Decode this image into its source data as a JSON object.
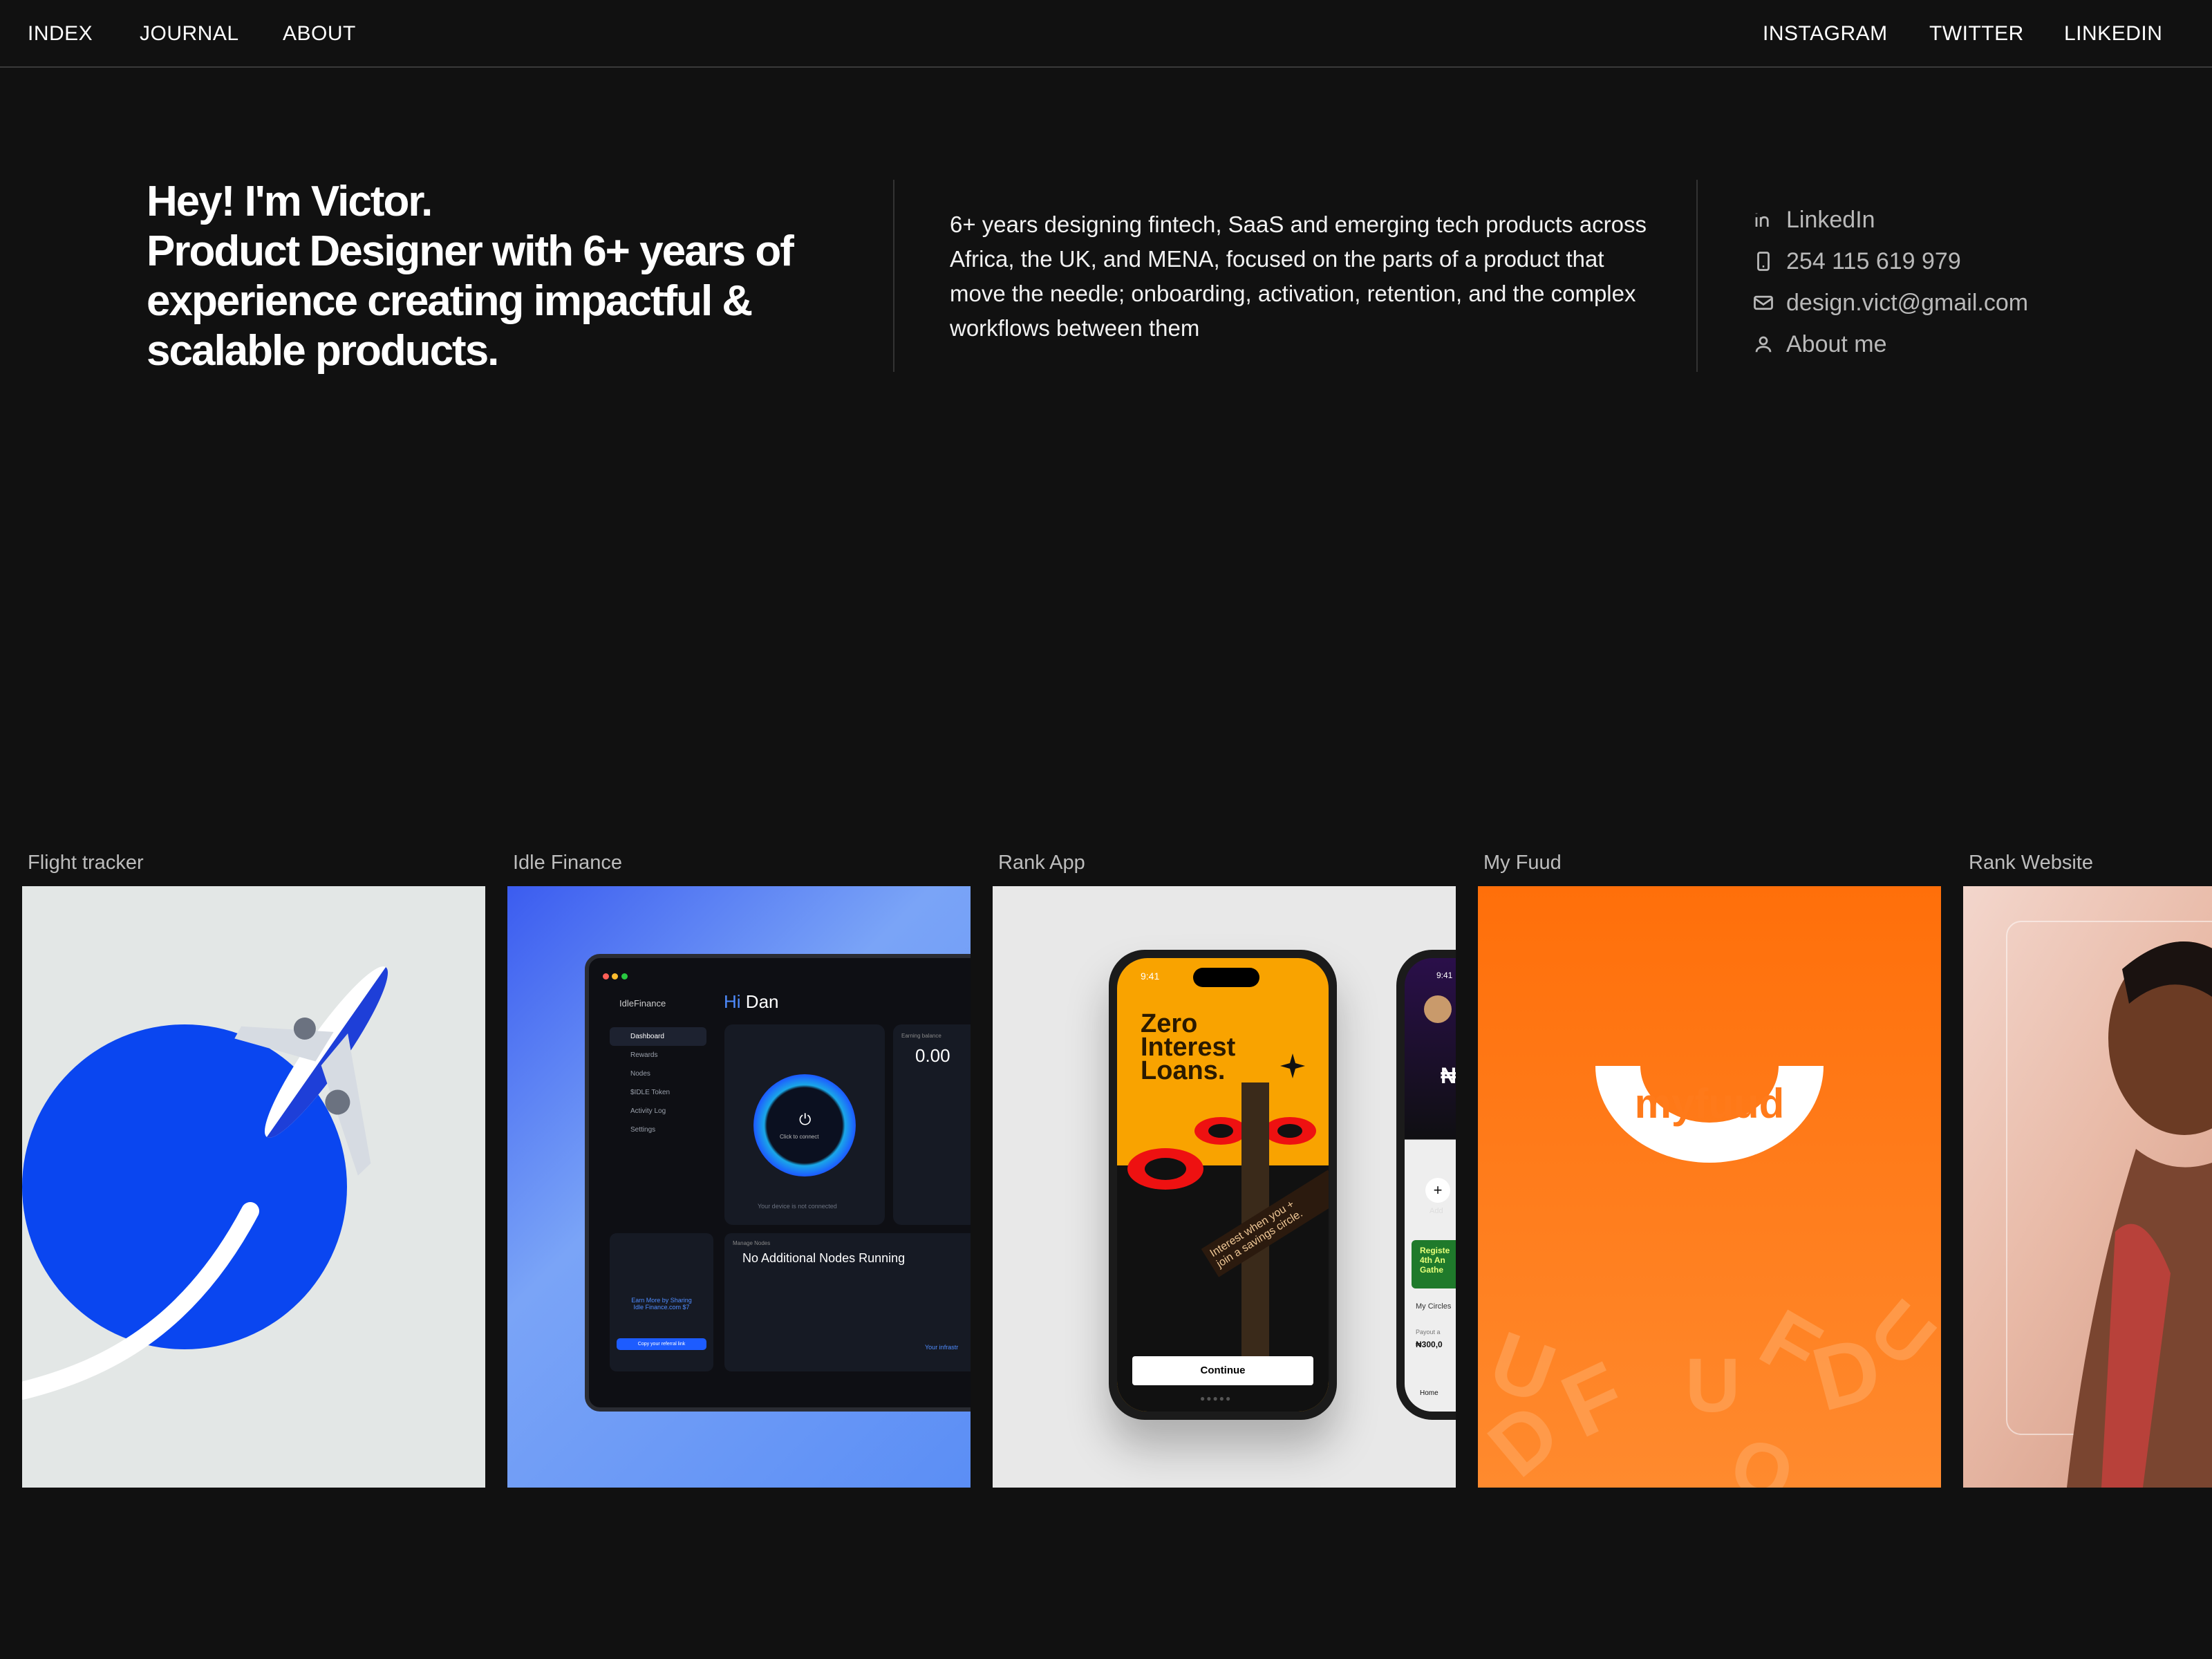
{
  "nav": {
    "left": [
      "INDEX",
      "JOURNAL",
      "ABOUT"
    ],
    "right": [
      "INSTAGRAM",
      "TWITTER",
      "LINKEDIN"
    ]
  },
  "hero": {
    "line1": "Hey! I'm Victor.",
    "line2": "Product Designer with 6+ years of experience creating impactful & scalable products."
  },
  "bio": "6+ years designing fintech, SaaS and emerging tech products across Africa, the UK, and MENA, focused on the parts of a product that move the needle; onboarding, activation, retention, and the complex workflows between them",
  "contacts": [
    {
      "icon": "linkedin-icon",
      "label": "LinkedIn"
    },
    {
      "icon": "phone-icon",
      "label": "254 115 619 979"
    },
    {
      "icon": "mail-icon",
      "label": "design.vict@gmail.com"
    },
    {
      "icon": "user-icon",
      "label": "About me"
    }
  ],
  "projects": [
    {
      "label": "Flight tracker"
    },
    {
      "label": "Idle Finance",
      "mock": {
        "app_name": "IdleFinance",
        "greeting_hi": "Hi",
        "greeting_name": "Dan",
        "menu": [
          "Dashboard",
          "Rewards",
          "Nodes",
          "$IDLE Token",
          "Activity Log",
          "Settings"
        ],
        "connect": "Click to connect",
        "not_connected": "Your device is not connected",
        "earning_label": "Earning balance",
        "earning_value": "0.00",
        "manage_label": "Manage Nodes",
        "nodes_status": "No Additional Nodes Running",
        "promo_line1": "Earn More by Sharing",
        "promo_line2": "Idle Finance.com $7",
        "promo_button": "Copy your referral link",
        "infra": "Your infrastr"
      }
    },
    {
      "label": "Rank App",
      "mock": {
        "time": "9:41",
        "headline": [
          "Zero",
          "Interest",
          "Loans."
        ],
        "sign_text": [
          "Interest when you +",
          "join a savings circle."
        ],
        "cta": "Continue",
        "currency": "₦9",
        "add": "Add",
        "green_card": [
          "Registe",
          "4th An",
          "Gathe"
        ],
        "my_circles": "My Circles",
        "payout": "Payout a",
        "payout_amount": "₦300,0",
        "home": "Home"
      }
    },
    {
      "label": "My Fuud",
      "mock": {
        "logo": "myfuud"
      }
    },
    {
      "label": "Rank Website"
    }
  ],
  "colors": {
    "background": "#111111",
    "flight_blue": "#0a46f0",
    "fuud_orange": "#ff7a1a",
    "rank_yellow": "#f9a300"
  }
}
